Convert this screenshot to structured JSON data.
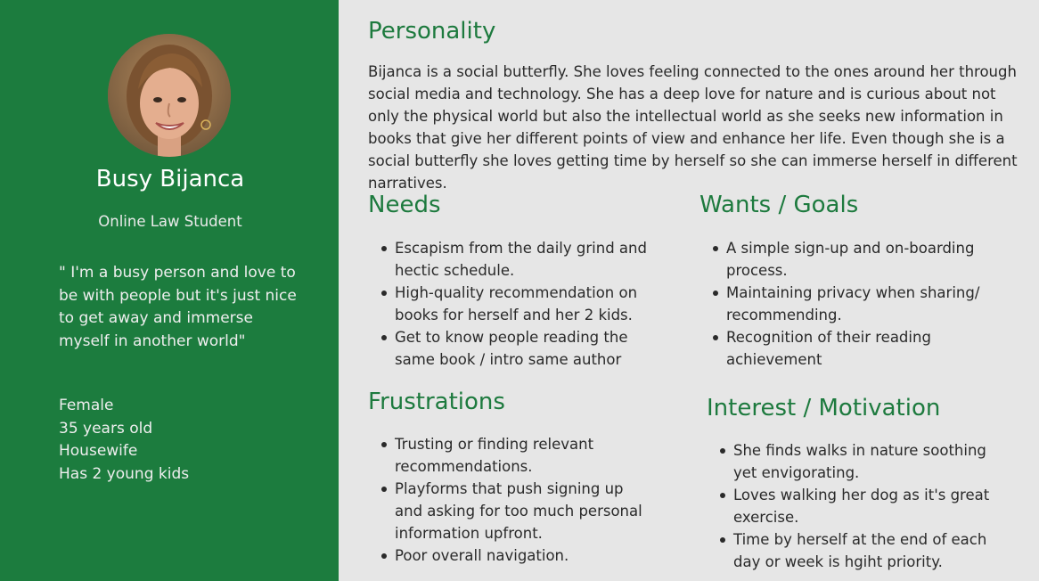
{
  "profile": {
    "name": "Busy Bijanca",
    "role": "Online Law Student",
    "quote": "\" I'm a busy person and love to be with people but it's just nice to get away and immerse myself in another world\"",
    "facts": [
      "Female",
      "35 years old",
      "Housewife",
      "Has 2 young kids"
    ]
  },
  "personality": {
    "heading": "Personality",
    "text": "Bijanca is a social butterfly. She loves feeling connected to the ones around her through social media and technology. She has a deep love for nature and is curious about not only the physical world but also the intellectual world as she seeks new information in books that give her different points of view and enhance her life. Even though she is a social butterfly she loves getting time by herself so she can immerse herself in different narratives."
  },
  "needs": {
    "heading": "Needs",
    "items": [
      "Escapism from the daily grind and hectic schedule.",
      "High-quality recommendation on books for herself and her 2 kids.",
      "Get to know people reading the same book / intro same author"
    ]
  },
  "wants": {
    "heading": "Wants / Goals",
    "items": [
      "A simple sign-up and on-boarding process.",
      "Maintaining privacy when sharing/ recommending.",
      "Recognition of their reading achievement"
    ]
  },
  "frustrations": {
    "heading": "Frustrations",
    "items": [
      "Trusting or finding relevant recommendations.",
      "Playforms that push signing up and asking for too much personal information upfront.",
      "Poor overall navigation."
    ]
  },
  "interest": {
    "heading": "Interest / Motivation",
    "items": [
      "She finds walks in nature soothing yet envigorating.",
      "Loves walking her dog as it's great exercise.",
      "Time by herself at the end of each day or week is hgiht priority."
    ]
  },
  "colors": {
    "sidebar": "#1c7c3e",
    "heading": "#1d7a3e",
    "background": "#e6e6e6"
  }
}
